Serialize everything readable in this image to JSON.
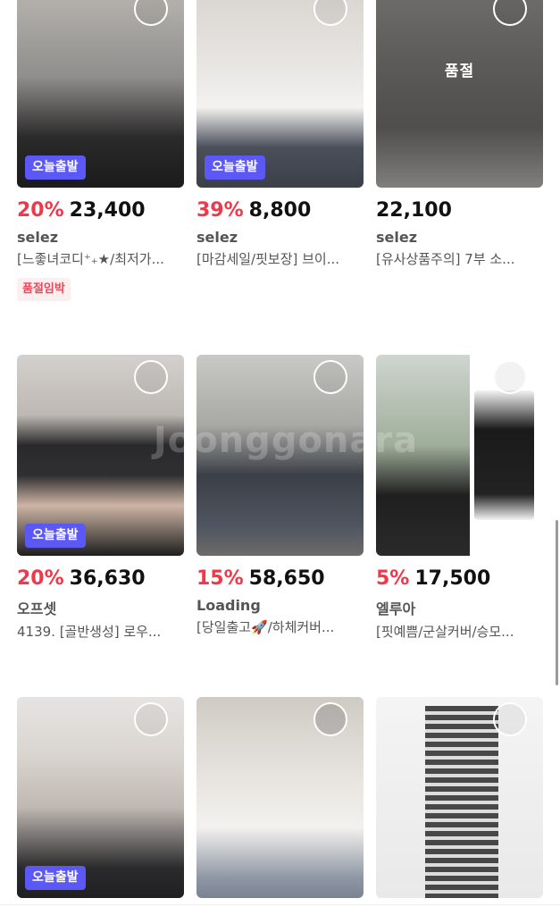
{
  "products": [
    {
      "discount": "20%",
      "price": "23,400",
      "brand": "selez",
      "title": "[느좋녀코디⁺₊★/최저가...",
      "badge": "오늘출발",
      "tag": "품절임박",
      "overlay": ""
    },
    {
      "discount": "39%",
      "price": "8,800",
      "brand": "selez",
      "title": "[마감세일/핏보장] 브이...",
      "badge": "오늘출발",
      "tag": "",
      "overlay": ""
    },
    {
      "discount": "",
      "price": "22,100",
      "brand": "selez",
      "title": "[유사상품주의] 7부 소...",
      "badge": "",
      "tag": "",
      "overlay": "품절"
    },
    {
      "discount": "20%",
      "price": "36,630",
      "brand": "오프셋",
      "title": "4139. [골반생성] 로우...",
      "badge": "오늘출발",
      "tag": "",
      "overlay": ""
    },
    {
      "discount": "15%",
      "price": "58,650",
      "brand": "Loading",
      "title": "[당일출고🚀/하체커버...",
      "badge": "",
      "tag": "",
      "overlay": ""
    },
    {
      "discount": "5%",
      "price": "17,500",
      "brand": "엘루아",
      "title": "[핏예쁨/군살커버/승모...",
      "badge": "",
      "tag": "",
      "overlay": ""
    },
    {
      "discount": "",
      "price": "",
      "brand": "",
      "title": "",
      "badge": "오늘출발",
      "tag": "",
      "overlay": ""
    },
    {
      "discount": "",
      "price": "",
      "brand": "",
      "title": "",
      "badge": "",
      "tag": "",
      "overlay": ""
    },
    {
      "discount": "",
      "price": "",
      "brand": "",
      "title": "",
      "badge": "",
      "tag": "",
      "overlay": ""
    }
  ],
  "watermark": "Joonggonara",
  "colors": {
    "discount": "#f0384b",
    "badge": "#5b58f5",
    "soon_bg": "#fdeef0",
    "soon_text": "#e74a5a"
  }
}
